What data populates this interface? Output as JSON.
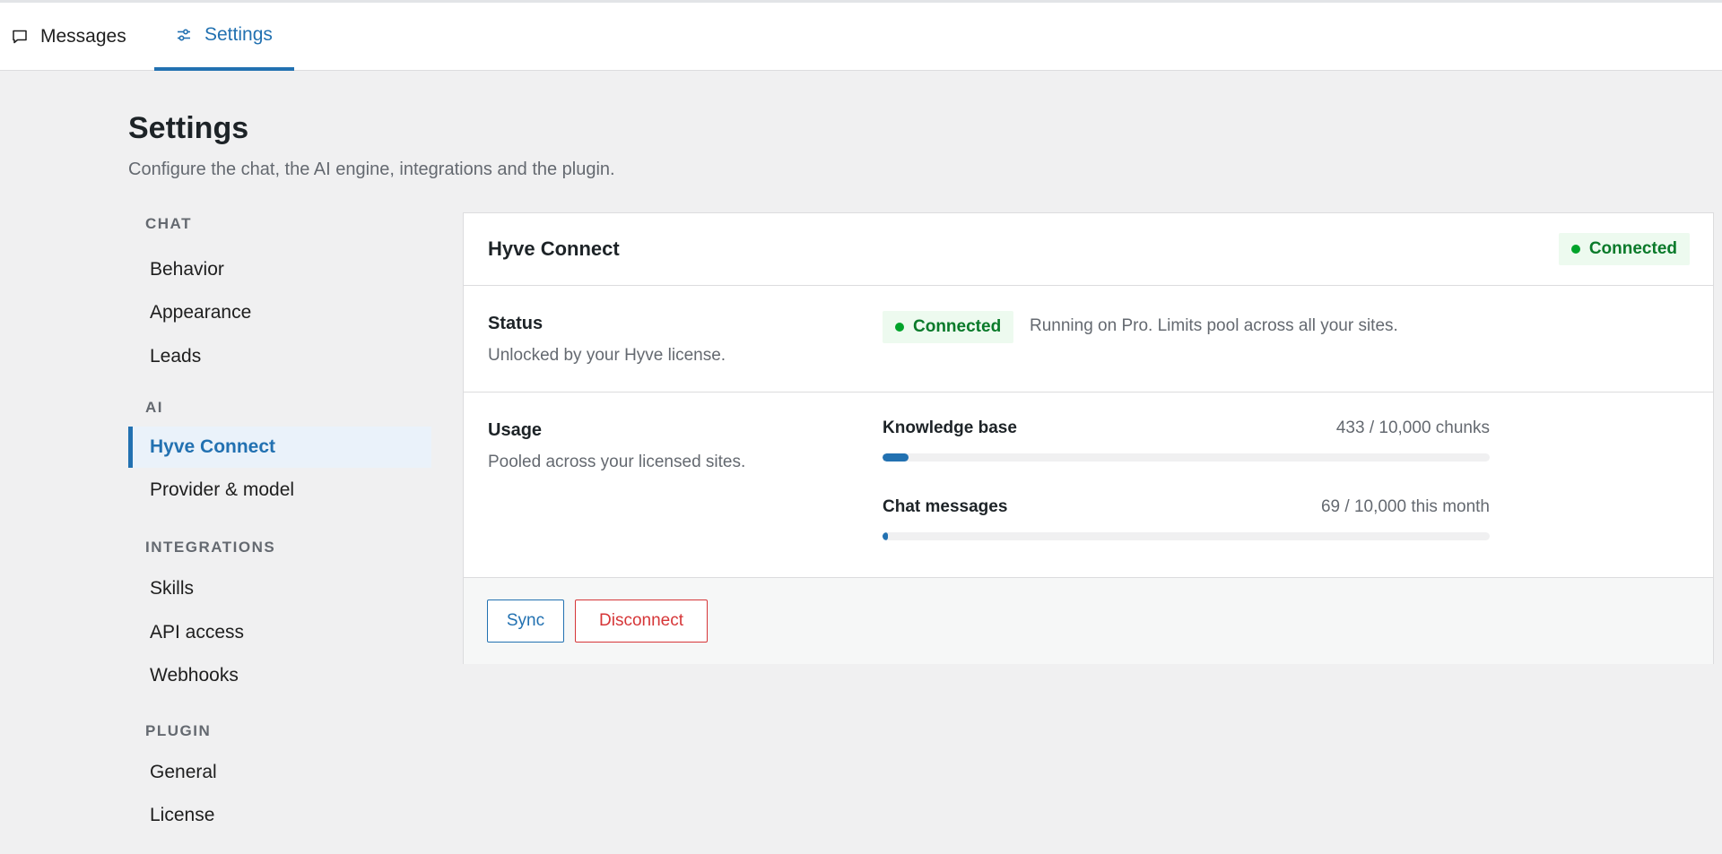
{
  "tabs": {
    "messages": "Messages",
    "settings": "Settings"
  },
  "page": {
    "title": "Settings",
    "description": "Configure the chat, the AI engine, integrations and the plugin."
  },
  "sidebar": {
    "sections": [
      {
        "title": "CHAT",
        "items": [
          "Behavior",
          "Appearance",
          "Leads"
        ]
      },
      {
        "title": "AI",
        "items": [
          "Hyve Connect",
          "Provider & model"
        ]
      },
      {
        "title": "INTEGRATIONS",
        "items": [
          "Skills",
          "API access",
          "Webhooks"
        ]
      },
      {
        "title": "PLUGIN",
        "items": [
          "General",
          "License"
        ]
      }
    ],
    "active": "Hyve Connect"
  },
  "card": {
    "title": "Hyve Connect",
    "header_badge": "Connected",
    "status": {
      "label": "Status",
      "description": "Unlocked by your Hyve license.",
      "badge": "Connected",
      "note": "Running on Pro. Limits pool across all your sites."
    },
    "usage": {
      "label": "Usage",
      "description": "Pooled across your licensed sites.",
      "meters": [
        {
          "name": "Knowledge base",
          "value": "433 / 10,000 chunks",
          "fraction": 0.0433
        },
        {
          "name": "Chat messages",
          "value": "69 / 10,000 this month",
          "fraction": 0.0069
        }
      ]
    },
    "actions": {
      "sync": "Sync",
      "disconnect": "Disconnect"
    }
  },
  "colors": {
    "accent": "#2271b1",
    "success": "#00a32a",
    "danger": "#d63638"
  }
}
